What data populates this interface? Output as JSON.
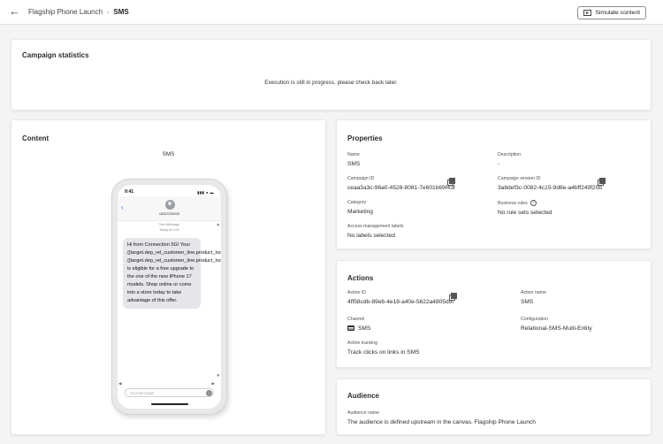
{
  "header": {
    "breadcrumb_parent": "Flagship Phone Launch",
    "breadcrumb_separator": "›",
    "breadcrumb_current": "SMS",
    "simulate_button": "Simulate content"
  },
  "stats": {
    "title": "Campaign statistics",
    "message": "Execution is still in progress, please check back later."
  },
  "content": {
    "title": "Content",
    "channel": "SMS",
    "phone": {
      "time": "9:41",
      "number": "18337290025",
      "thread_label": "Text Message",
      "thread_time": "Today at 9:41",
      "message": "Hi from Connection 5G! Your {{target.dep_rel_customer_line.product_lookup.make}} {{target.dep_rel_customer_line.product_lookup.model}} is eligible for a free upgrade to the one of the new iPhone 17 models. Shop online or come into a store today to take advantage of this offer.",
      "input_placeholder": "Text Message"
    }
  },
  "properties": {
    "title": "Properties",
    "name_label": "Name",
    "name_value": "SMS",
    "description_label": "Description",
    "description_value": "-",
    "campaign_id_label": "Campaign ID",
    "campaign_id_value": "ceaa3a3c-96a0-4528-8081-7e601b69f43f",
    "campaign_version_label": "Campaign version ID",
    "campaign_version_value": "3a8def3c-0082-4c15-9d8e-a4bff249f20b",
    "category_label": "Category",
    "category_value": "Marketing",
    "business_rules_label": "Business rules",
    "business_rules_value": "No rule sets selected",
    "access_labels_label": "Access management labels",
    "access_labels_value": "No labels selected"
  },
  "actions": {
    "title": "Actions",
    "action_id_label": "Action ID",
    "action_id_value": "4ff58cdb-89e6-4e18-a40e-5622a4805d9f",
    "action_name_label": "Action name",
    "action_name_value": "SMS",
    "channel_label": "Channel",
    "channel_value": "SMS",
    "configuration_label": "Configuration",
    "configuration_value": "Relational-SMS-Multi-Entity",
    "tracking_label": "Action tracking",
    "tracking_value": "Track clicks on links in SMS"
  },
  "audience": {
    "title": "Audience",
    "name_label": "Audience name",
    "name_value": "The audience is defined upstream in the canvas. Flagship Phone Launch"
  }
}
